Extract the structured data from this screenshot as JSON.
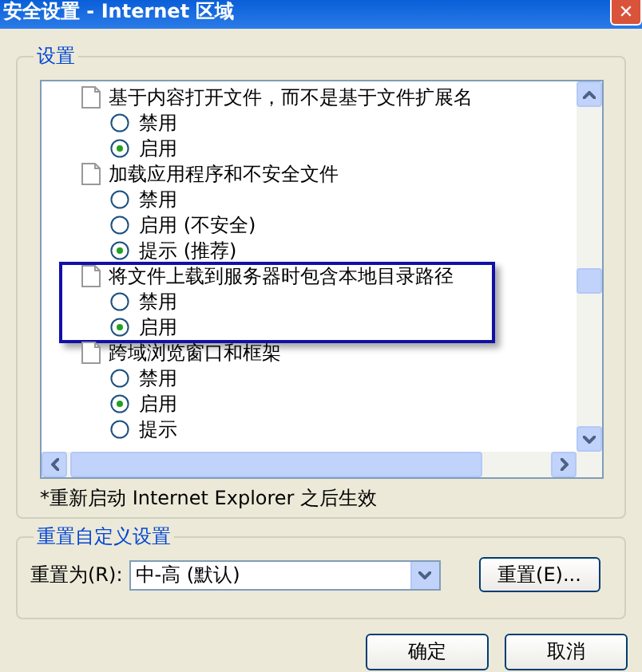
{
  "window": {
    "title": "安全设置 - Internet 区域",
    "close": "✕"
  },
  "settings_group": {
    "title": "设置",
    "items": [
      {
        "label": "基于内容打开文件，而不是基于文件扩展名",
        "highlighted": false,
        "options": [
          {
            "label": "禁用",
            "selected": false
          },
          {
            "label": "启用",
            "selected": true
          }
        ]
      },
      {
        "label": "加载应用程序和不安全文件",
        "highlighted": false,
        "options": [
          {
            "label": "禁用",
            "selected": false
          },
          {
            "label": "启用 (不安全)",
            "selected": false
          },
          {
            "label": "提示 (推荐)",
            "selected": true
          }
        ]
      },
      {
        "label": "将文件上载到服务器时包含本地目录路径",
        "highlighted": true,
        "options": [
          {
            "label": "禁用",
            "selected": false
          },
          {
            "label": "启用",
            "selected": true
          }
        ]
      },
      {
        "label": "跨域浏览窗口和框架",
        "highlighted": false,
        "options": [
          {
            "label": "禁用",
            "selected": false
          },
          {
            "label": "启用",
            "selected": true
          },
          {
            "label": "提示",
            "selected": false
          }
        ]
      }
    ],
    "note": "*重新启动 Internet Explorer 之后生效"
  },
  "reset_group": {
    "title": "重置自定义设置",
    "label": "重置为(R):",
    "value": "中-高 (默认)",
    "button": "重置(E)..."
  },
  "buttons": [
    "确定",
    "取消"
  ]
}
